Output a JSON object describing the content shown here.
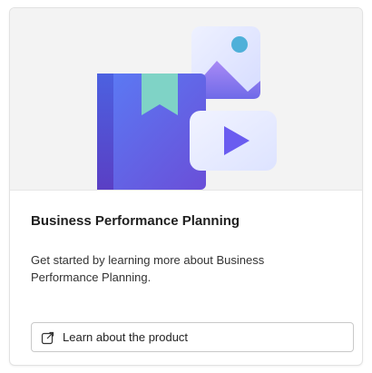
{
  "card": {
    "title": "Business Performance Planning",
    "description": "Get started by learning more about Business Performance Planning.",
    "action": {
      "label": "Learn about the product",
      "icon": "open-in-new-window-icon"
    },
    "illustration": {
      "icons": [
        "book-icon",
        "image-icon",
        "video-play-icon"
      ]
    },
    "colors": {
      "hero_bg": "#f3f3f3",
      "book": "#5b6cf0",
      "bookmark": "#7fd3c6",
      "play": "#6a5cf0",
      "sun": "#4fb0d9"
    }
  }
}
